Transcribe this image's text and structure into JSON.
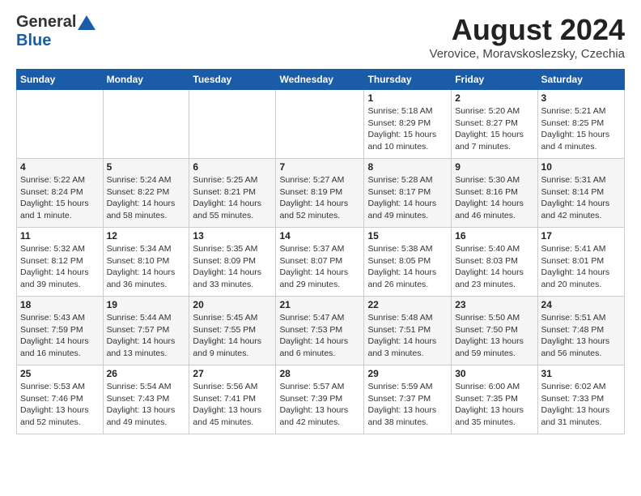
{
  "header": {
    "logo_general": "General",
    "logo_blue": "Blue",
    "month_title": "August 2024",
    "location": "Verovice, Moravskoslezsky, Czechia"
  },
  "days_of_week": [
    "Sunday",
    "Monday",
    "Tuesday",
    "Wednesday",
    "Thursday",
    "Friday",
    "Saturday"
  ],
  "weeks": [
    [
      {
        "day": "",
        "info": ""
      },
      {
        "day": "",
        "info": ""
      },
      {
        "day": "",
        "info": ""
      },
      {
        "day": "",
        "info": ""
      },
      {
        "day": "1",
        "info": "Sunrise: 5:18 AM\nSunset: 8:29 PM\nDaylight: 15 hours\nand 10 minutes."
      },
      {
        "day": "2",
        "info": "Sunrise: 5:20 AM\nSunset: 8:27 PM\nDaylight: 15 hours\nand 7 minutes."
      },
      {
        "day": "3",
        "info": "Sunrise: 5:21 AM\nSunset: 8:25 PM\nDaylight: 15 hours\nand 4 minutes."
      }
    ],
    [
      {
        "day": "4",
        "info": "Sunrise: 5:22 AM\nSunset: 8:24 PM\nDaylight: 15 hours\nand 1 minute."
      },
      {
        "day": "5",
        "info": "Sunrise: 5:24 AM\nSunset: 8:22 PM\nDaylight: 14 hours\nand 58 minutes."
      },
      {
        "day": "6",
        "info": "Sunrise: 5:25 AM\nSunset: 8:21 PM\nDaylight: 14 hours\nand 55 minutes."
      },
      {
        "day": "7",
        "info": "Sunrise: 5:27 AM\nSunset: 8:19 PM\nDaylight: 14 hours\nand 52 minutes."
      },
      {
        "day": "8",
        "info": "Sunrise: 5:28 AM\nSunset: 8:17 PM\nDaylight: 14 hours\nand 49 minutes."
      },
      {
        "day": "9",
        "info": "Sunrise: 5:30 AM\nSunset: 8:16 PM\nDaylight: 14 hours\nand 46 minutes."
      },
      {
        "day": "10",
        "info": "Sunrise: 5:31 AM\nSunset: 8:14 PM\nDaylight: 14 hours\nand 42 minutes."
      }
    ],
    [
      {
        "day": "11",
        "info": "Sunrise: 5:32 AM\nSunset: 8:12 PM\nDaylight: 14 hours\nand 39 minutes."
      },
      {
        "day": "12",
        "info": "Sunrise: 5:34 AM\nSunset: 8:10 PM\nDaylight: 14 hours\nand 36 minutes."
      },
      {
        "day": "13",
        "info": "Sunrise: 5:35 AM\nSunset: 8:09 PM\nDaylight: 14 hours\nand 33 minutes."
      },
      {
        "day": "14",
        "info": "Sunrise: 5:37 AM\nSunset: 8:07 PM\nDaylight: 14 hours\nand 29 minutes."
      },
      {
        "day": "15",
        "info": "Sunrise: 5:38 AM\nSunset: 8:05 PM\nDaylight: 14 hours\nand 26 minutes."
      },
      {
        "day": "16",
        "info": "Sunrise: 5:40 AM\nSunset: 8:03 PM\nDaylight: 14 hours\nand 23 minutes."
      },
      {
        "day": "17",
        "info": "Sunrise: 5:41 AM\nSunset: 8:01 PM\nDaylight: 14 hours\nand 20 minutes."
      }
    ],
    [
      {
        "day": "18",
        "info": "Sunrise: 5:43 AM\nSunset: 7:59 PM\nDaylight: 14 hours\nand 16 minutes."
      },
      {
        "day": "19",
        "info": "Sunrise: 5:44 AM\nSunset: 7:57 PM\nDaylight: 14 hours\nand 13 minutes."
      },
      {
        "day": "20",
        "info": "Sunrise: 5:45 AM\nSunset: 7:55 PM\nDaylight: 14 hours\nand 9 minutes."
      },
      {
        "day": "21",
        "info": "Sunrise: 5:47 AM\nSunset: 7:53 PM\nDaylight: 14 hours\nand 6 minutes."
      },
      {
        "day": "22",
        "info": "Sunrise: 5:48 AM\nSunset: 7:51 PM\nDaylight: 14 hours\nand 3 minutes."
      },
      {
        "day": "23",
        "info": "Sunrise: 5:50 AM\nSunset: 7:50 PM\nDaylight: 13 hours\nand 59 minutes."
      },
      {
        "day": "24",
        "info": "Sunrise: 5:51 AM\nSunset: 7:48 PM\nDaylight: 13 hours\nand 56 minutes."
      }
    ],
    [
      {
        "day": "25",
        "info": "Sunrise: 5:53 AM\nSunset: 7:46 PM\nDaylight: 13 hours\nand 52 minutes."
      },
      {
        "day": "26",
        "info": "Sunrise: 5:54 AM\nSunset: 7:43 PM\nDaylight: 13 hours\nand 49 minutes."
      },
      {
        "day": "27",
        "info": "Sunrise: 5:56 AM\nSunset: 7:41 PM\nDaylight: 13 hours\nand 45 minutes."
      },
      {
        "day": "28",
        "info": "Sunrise: 5:57 AM\nSunset: 7:39 PM\nDaylight: 13 hours\nand 42 minutes."
      },
      {
        "day": "29",
        "info": "Sunrise: 5:59 AM\nSunset: 7:37 PM\nDaylight: 13 hours\nand 38 minutes."
      },
      {
        "day": "30",
        "info": "Sunrise: 6:00 AM\nSunset: 7:35 PM\nDaylight: 13 hours\nand 35 minutes."
      },
      {
        "day": "31",
        "info": "Sunrise: 6:02 AM\nSunset: 7:33 PM\nDaylight: 13 hours\nand 31 minutes."
      }
    ]
  ]
}
